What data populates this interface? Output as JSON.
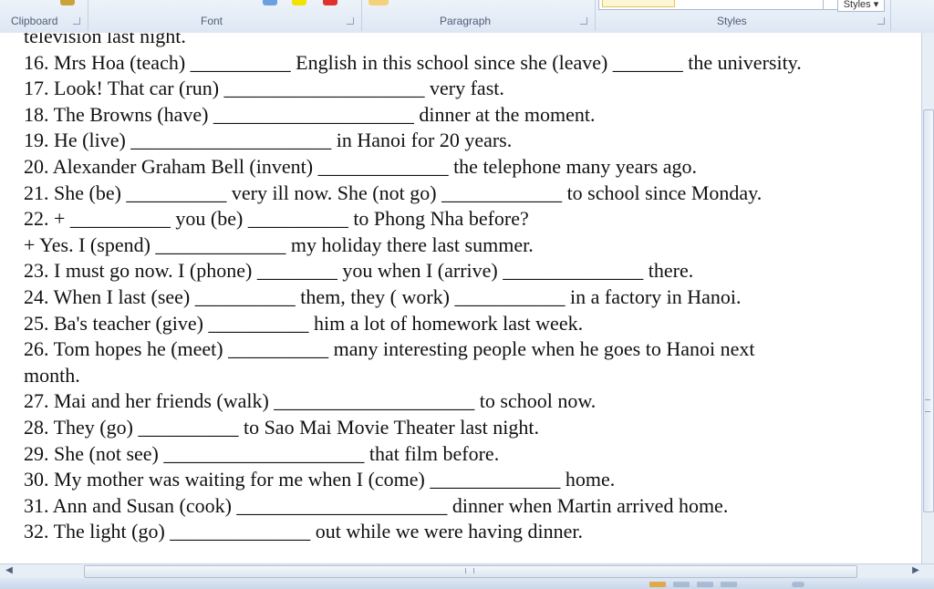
{
  "ribbon": {
    "groups": {
      "clipboard": "Clipboard",
      "font": "Font",
      "paragraph": "Paragraph",
      "styles": "Styles"
    },
    "styles_button": "Styles ▾"
  },
  "document": {
    "lines": [
      "television last night.",
      "16. Mrs Hoa (teach) __________ English in this school since she (leave) _______ the university.",
      "17. Look! That car (run) ____________________ very fast.",
      "18. The Browns (have) ____________________ dinner at the moment.",
      "19. He (live) ____________________ in Hanoi for 20 years.",
      "20. Alexander Graham Bell (invent) _____________ the telephone many years ago.",
      "21. She (be) __________ very ill now. She (not go) ____________ to school since Monday.",
      "22. + __________ you (be) __________ to Phong Nha before?",
      "+ Yes. I (spend) _____________ my holiday there last summer.",
      "23. I must go now. I (phone) ________ you when I (arrive) ______________ there.",
      "24. When I last (see) __________ them, they ( work) ___________ in a factory in Hanoi.",
      "25. Ba's teacher (give) __________ him a lot of homework last week.",
      "26. Tom hopes he (meet) __________ many interesting people when he goes to Hanoi next",
      "month.",
      "27. Mai and her friends (walk) ____________________ to school now.",
      "28. They (go) __________ to Sao Mai Movie Theater last night.",
      "29. She (not see) ____________________ that film before.",
      "30. My mother was waiting for me when I (come) _____________ home.",
      "31. Ann and Susan (cook) _____________________ dinner when Martin arrived home.",
      "32. The light (go) ______________ out while we were having dinner."
    ]
  },
  "scrollbars": {
    "left_arrow": "◀",
    "right_arrow": "▶"
  }
}
